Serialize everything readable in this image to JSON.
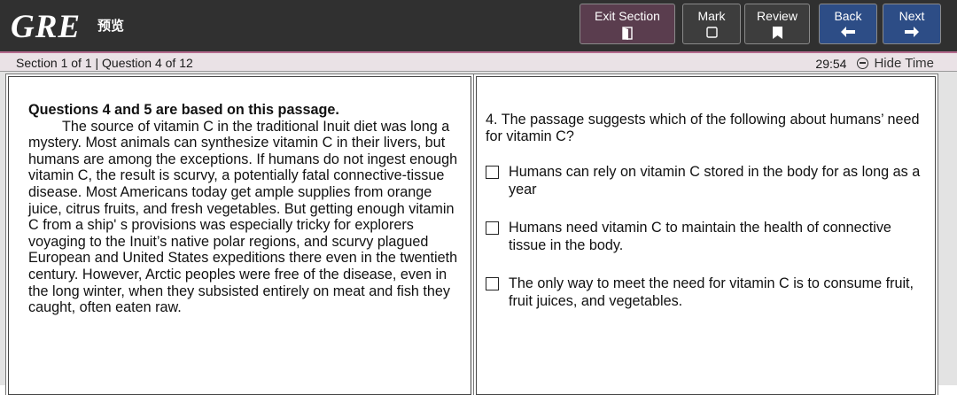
{
  "header": {
    "logo": "GRE",
    "preview_label": "预览",
    "buttons": {
      "exit_section": "Exit Section",
      "mark": "Mark",
      "review": "Review",
      "back": "Back",
      "next": "Next"
    }
  },
  "status": {
    "section_info": "Section 1 of 1 | Question 4 of 12",
    "timer": "29:54",
    "hide_time": "Hide Time"
  },
  "passage": {
    "heading": "Questions 4 and 5 are based on this passage.",
    "text": "The source of vitamin C in the traditional Inuit diet was long a mystery. Most animals can synthesize vitamin C in their livers, but humans are among the exceptions. If humans do not ingest enough vitamin C, the result is scurvy, a potentially fatal connective-tissue disease. Most Americans today get ample supplies from orange juice, citrus fruits, and fresh vegetables. But getting enough vitamin C from a ship' s provisions was especially tricky for explorers voyaging to the Inuit’s native polar regions, and scurvy plagued European and United States expeditions there even in the twentieth century. However, Arctic peoples were free of the disease, even in the long winter, when they subsisted entirely on meat and fish they caught, often eaten raw."
  },
  "question": {
    "prompt": "4. The passage suggests which of the following about humans’ need for vitamin C?",
    "options": [
      "Humans can rely on vitamin C stored in the body for as long as a year",
      "Humans need vitamin C to maintain the health of connective tissue in the body.",
      "The only way to meet the need for vitamin C is to consume fruit, fruit juices, and vegetables."
    ]
  }
}
